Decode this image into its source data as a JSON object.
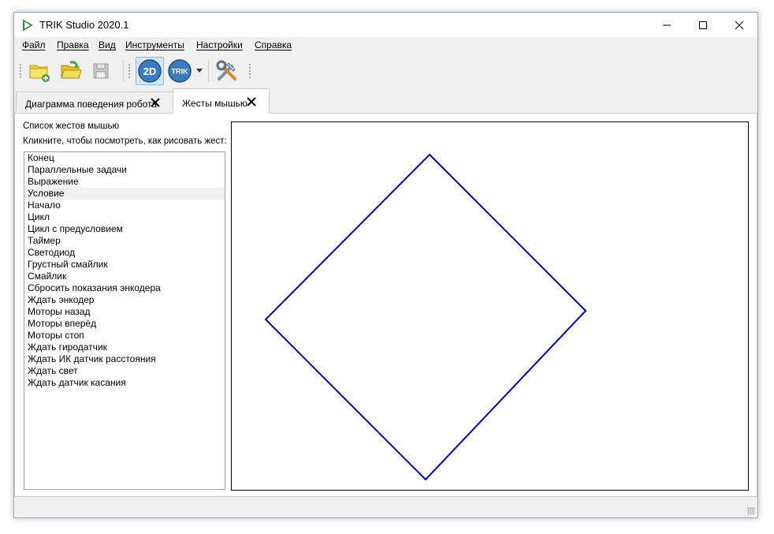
{
  "window": {
    "title": "TRIK Studio 2020.1"
  },
  "menu": {
    "items": [
      "Файл",
      "Правка",
      "Вид",
      "Инструменты",
      "Настройки",
      "Справка"
    ]
  },
  "toolbar": {
    "buttons": [
      {
        "icon": "new-project-icon"
      },
      {
        "icon": "open-folder-icon"
      },
      {
        "icon": "save-icon"
      },
      {
        "icon": "mode-2d-icon",
        "text": "2D",
        "active": true
      },
      {
        "icon": "trik-robot-icon",
        "text": "TRIK"
      },
      {
        "icon": "settings-tools-icon"
      }
    ]
  },
  "tabs": [
    {
      "label": "Диаграмма поведения робота",
      "active": false
    },
    {
      "label": "Жесты мышью",
      "active": true
    }
  ],
  "gestures_panel": {
    "title": "Список жестов мышью",
    "hint": "Кликните, чтобы посмотреть, как рисовать жест:",
    "selected_index": 3,
    "items": [
      "Конец",
      "Параллельные задачи",
      "Выражение",
      "Условие",
      "Начало",
      "Цикл",
      "Цикл с предусловием",
      "Таймер",
      "Светодиод",
      "Грустный смайлик",
      "Смайлик",
      "Сбросить показания энкодера",
      "Ждать энкодер",
      "Моторы назад",
      "Моторы вперёд",
      "Моторы стоп",
      "Ждать гиродатчик",
      "Ждать ИК датчик расстояния",
      "Ждать свет",
      "Ждать датчик касания"
    ]
  },
  "gesture_canvas": {
    "shape": "diamond",
    "stroke_color": "#0000cc"
  },
  "colors": {
    "accent": "#3a7cc0",
    "gesture_stroke": "#0000cc",
    "active_tool_bg": "#d5e6f5"
  }
}
